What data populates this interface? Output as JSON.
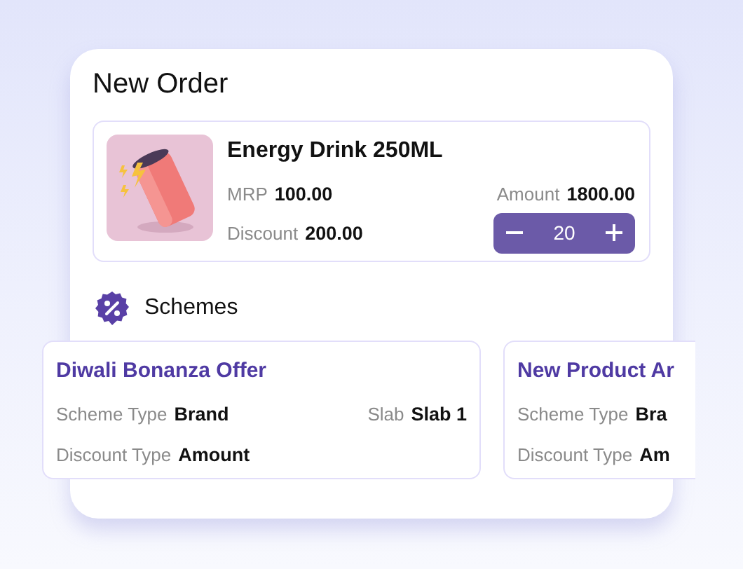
{
  "title": "New Order",
  "product": {
    "name": "Energy Drink 250ML",
    "image": {
      "kind": "picture"
    },
    "rows": [
      [
        {
          "label": "MRP",
          "value": "100.00"
        },
        {
          "label": "Amount",
          "value": "1800.00"
        }
      ],
      [
        {
          "label": "Discount",
          "value": "200.00"
        }
      ]
    ],
    "quantity": "20"
  },
  "schemes_heading": "Schemes",
  "schemes": [
    {
      "title": "Diwali Bonanza Offer",
      "rows": [
        [
          {
            "label": "Scheme Type",
            "value": "Brand"
          },
          {
            "label": "Slab",
            "value": "Slab 1"
          }
        ],
        [
          {
            "label": "Discount Type",
            "value": "Amount"
          }
        ]
      ]
    },
    {
      "title": "New Product Ar",
      "rows": [
        [
          {
            "label": "Scheme Type",
            "value": "Bra"
          }
        ],
        [
          {
            "label": "Discount Type",
            "value": "Am"
          }
        ]
      ]
    }
  ]
}
